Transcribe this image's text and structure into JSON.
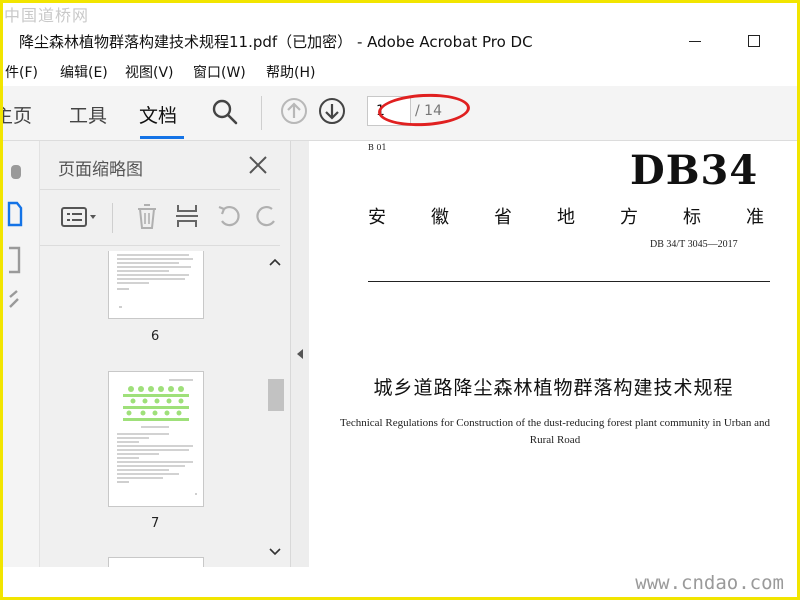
{
  "watermarks": {
    "top": "中国道桥网",
    "bottom": "www.cndao.com"
  },
  "window": {
    "title": "降尘森林植物群落构建技术规程11.pdf（已加密） - Adobe Acrobat Pro DC"
  },
  "menu": [
    "件(F)",
    "编辑(E)",
    "视图(V)",
    "窗口(W)",
    "帮助(H)"
  ],
  "toolbar": {
    "tabs": [
      "主页",
      "工具",
      "文档"
    ],
    "active_tab": "文档",
    "page_current": "1",
    "page_total": "/ 14"
  },
  "thumbnails_panel": {
    "title": "页面缩略图",
    "pages": [
      {
        "label": "6"
      },
      {
        "label": "7"
      }
    ]
  },
  "document": {
    "classification": "B 01",
    "standard_prefix": "DB34",
    "province_chars": [
      "安",
      "徽",
      "省",
      "地",
      "方",
      "标",
      "准"
    ],
    "standard_number": "DB 34/T 3045—2017",
    "title_cn": "城乡道路降尘森林植物群落构建技术规程",
    "title_en": "Technical Regulations for Construction of the dust-reducing forest plant community in Urban and Rural Road"
  },
  "colors": {
    "accent": "#1473e6",
    "highlight": "#e02020",
    "frame": "#f2e500"
  }
}
